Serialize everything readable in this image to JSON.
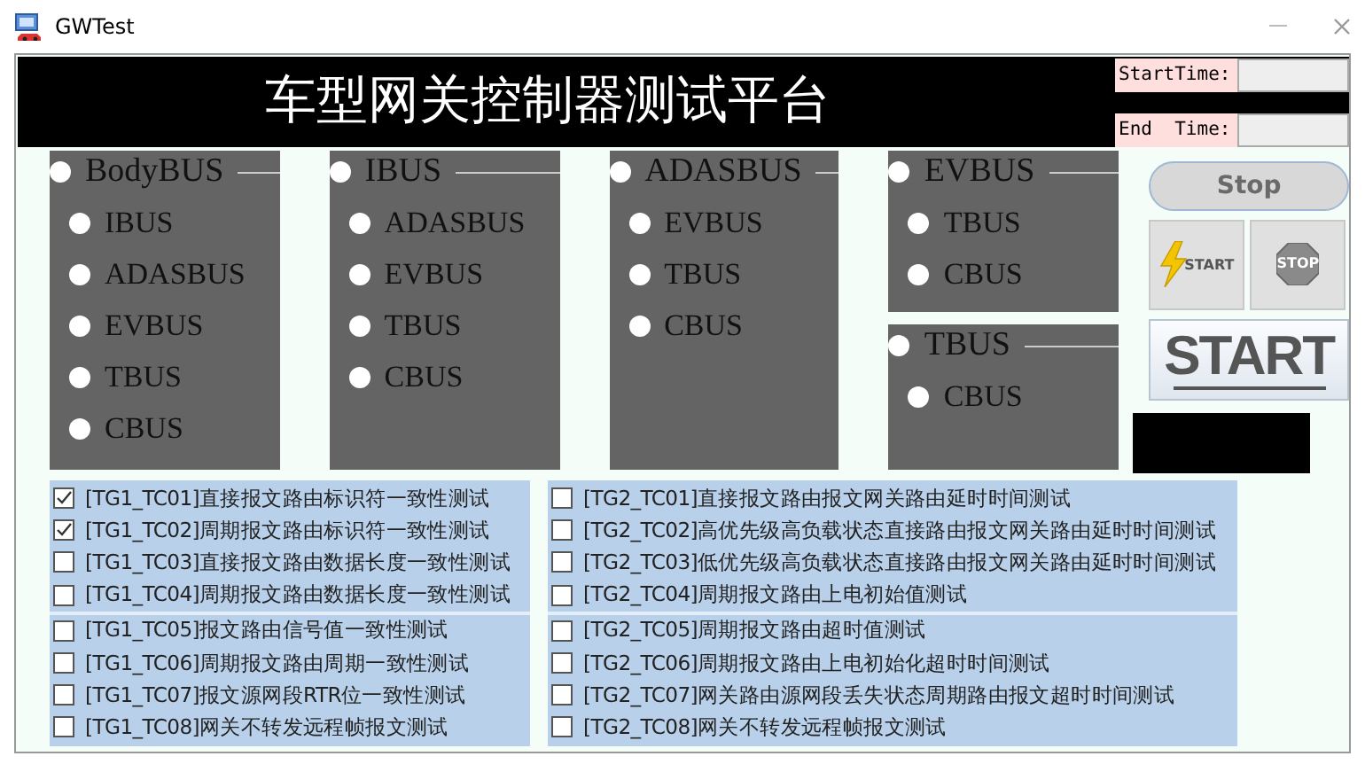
{
  "window": {
    "title": "GWTest"
  },
  "header": {
    "title": "车型网关控制器测试平台",
    "time_fields": [
      {
        "label": "StartTime:"
      },
      {
        "label": "End  Time:"
      }
    ]
  },
  "bus_columns": [
    {
      "groups": [
        {
          "name": "BodyBUS",
          "selected": false,
          "options": [
            {
              "label": "IBUS",
              "selected": false
            },
            {
              "label": "ADASBUS",
              "selected": false
            },
            {
              "label": "EVBUS",
              "selected": false
            },
            {
              "label": "TBUS",
              "selected": false
            },
            {
              "label": "CBUS",
              "selected": false
            }
          ]
        }
      ]
    },
    {
      "groups": [
        {
          "name": "IBUS",
          "selected": false,
          "options": [
            {
              "label": "ADASBUS",
              "selected": false
            },
            {
              "label": "EVBUS",
              "selected": false
            },
            {
              "label": "TBUS",
              "selected": false
            },
            {
              "label": "CBUS",
              "selected": false
            }
          ]
        }
      ]
    },
    {
      "groups": [
        {
          "name": "ADASBUS",
          "selected": false,
          "options": [
            {
              "label": "EVBUS",
              "selected": false
            },
            {
              "label": "TBUS",
              "selected": false
            },
            {
              "label": "CBUS",
              "selected": false
            }
          ]
        }
      ]
    },
    {
      "groups": [
        {
          "name": "EVBUS",
          "selected": false,
          "options": [
            {
              "label": "TBUS",
              "selected": false
            },
            {
              "label": "CBUS",
              "selected": false
            }
          ]
        },
        {
          "name": "TBUS",
          "selected": false,
          "options": [
            {
              "label": "CBUS",
              "selected": false
            }
          ]
        }
      ]
    }
  ],
  "controls": [
    {
      "kind": "pill",
      "label": "Stop",
      "disabled": true
    },
    {
      "kind": "lightning",
      "label": "START"
    },
    {
      "kind": "stop-sign",
      "label": "STOP"
    },
    {
      "kind": "big",
      "label": "START"
    }
  ],
  "test_groups": [
    {
      "blocks": [
        {
          "items": [
            {
              "label": "[TG1_TC01]直接报文路由标识符一致性测试",
              "checked": true
            },
            {
              "label": "[TG1_TC02]周期报文路由标识符一致性测试",
              "checked": true
            },
            {
              "label": "[TG1_TC03]直接报文路由数据长度一致性测试",
              "checked": false
            },
            {
              "label": "[TG1_TC04]周期报文路由数据长度一致性测试",
              "checked": false
            }
          ]
        },
        {
          "items": [
            {
              "label": "[TG1_TC05]报文路由信号值一致性测试",
              "checked": false
            },
            {
              "label": "[TG1_TC06]周期报文路由周期一致性测试",
              "checked": false
            },
            {
              "label": "[TG1_TC07]报文源网段RTR位一致性测试",
              "checked": false
            },
            {
              "label": "[TG1_TC08]网关不转发远程帧报文测试",
              "checked": false
            }
          ]
        }
      ]
    },
    {
      "blocks": [
        {
          "items": [
            {
              "label": "[TG2_TC01]直接报文路由报文网关路由延时时间测试",
              "checked": false
            },
            {
              "label": "[TG2_TC02]高优先级高负载状态直接路由报文网关路由延时时间测试",
              "checked": false
            },
            {
              "label": "[TG2_TC03]低优先级高负载状态直接路由报文网关路由延时时间测试",
              "checked": false
            },
            {
              "label": "[TG2_TC04]周期报文路由上电初始值测试",
              "checked": false
            }
          ]
        },
        {
          "items": [
            {
              "label": "[TG2_TC05]周期报文路由超时值测试",
              "checked": false
            },
            {
              "label": "[TG2_TC06]周期报文路由上电初始化超时时间测试",
              "checked": false
            },
            {
              "label": "[TG2_TC07]网关路由源网段丢失状态周期路由报文超时时间测试",
              "checked": false
            },
            {
              "label": "[TG2_TC08]网关不转发远程帧报文测试",
              "checked": false
            }
          ]
        }
      ]
    }
  ]
}
